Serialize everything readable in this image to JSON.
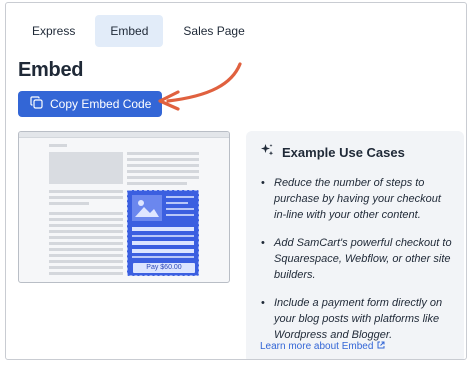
{
  "tabs": [
    {
      "label": "Express",
      "active": false
    },
    {
      "label": "Embed",
      "active": true
    },
    {
      "label": "Sales Page",
      "active": false
    }
  ],
  "page": {
    "title": "Embed",
    "copy_button_label": "Copy Embed Code",
    "copy_icon": "copy-icon"
  },
  "preview": {
    "pay_label": "Pay $60.00"
  },
  "use_cases": {
    "icon": "sparkle-icon",
    "title": "Example Use Cases",
    "items": [
      "Reduce the number of steps to purchase by having your checkout in-line with your other content.",
      "Add SamCart's powerful checkout to Squarespace, Webflow, or other site builders.",
      "Include a payment form directly on your blog posts with platforms like Wordpress and Blogger."
    ],
    "learn_more": "Learn more about Embed",
    "external_icon": "external-link-icon"
  },
  "colors": {
    "accent": "#3366d6",
    "arrow": "#e0613f",
    "tab_active_bg": "#e2ecf9",
    "panel_bg": "#f2f4f7"
  }
}
